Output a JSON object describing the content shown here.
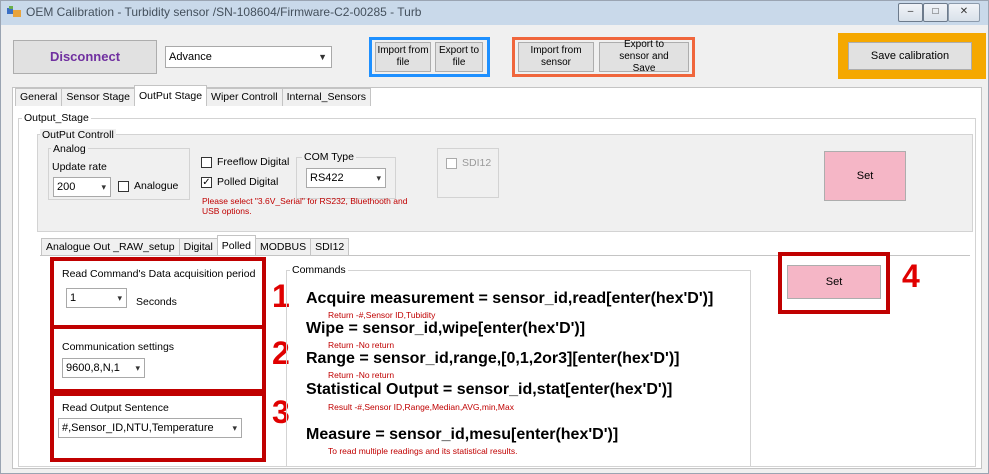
{
  "window": {
    "title": "OEM Calibration - Turbidity sensor /SN-108604/Firmware-C2-00285 - Turb",
    "controls": [
      "–",
      "□",
      "✕"
    ]
  },
  "toolbar": {
    "disconnect_label": "Disconnect",
    "mode_value": "Advance",
    "import_file_label": "Import from file",
    "export_file_label": "Export to file",
    "import_sensor_label": "Import from sensor",
    "export_sensor_label": "Export to sensor and Save",
    "save_calibration_label": "Save calibration"
  },
  "colors": {
    "blue_outline": "#1e90ff",
    "orange_outline": "#f0663c",
    "gold_panel": "#f5a800",
    "pink_button": "#f5b6c6",
    "red_highlight": "#c00000",
    "disconnect_text": "#7030a0"
  },
  "main_tabs": [
    "General",
    "Sensor Stage",
    "OutPut Stage",
    "Wiper Controll",
    "Internal_Sensors"
  ],
  "main_tabs_active": "OutPut Stage",
  "output_stage": {
    "group_label": "Output_Stage",
    "control_label": "OutPut Controll",
    "analog": {
      "group_label": "Analog",
      "update_rate_label": "Update rate",
      "update_rate_value": "200",
      "analogue_label": "Analogue",
      "analogue_checked": false
    },
    "freeflow_label": "Freeflow Digital",
    "freeflow_checked": false,
    "polled_label": "Polled Digital",
    "polled_checked": true,
    "com_type_label": "COM Type",
    "com_type_value": "RS422",
    "warning_line1": "Please select \"3.6V_Serial\" for RS232, Bluethooth and",
    "warning_line2": "USB options.",
    "sdi12_label": "SDI12",
    "sdi12_checked": false,
    "set_label": "Set"
  },
  "sub_tabs": [
    "Analogue Out _RAW_setup",
    "Digital",
    "Polled",
    "MODBUS",
    "SDI12"
  ],
  "sub_tabs_active": "Polled",
  "polled": {
    "period_group_label": "Read Command's Data acquisition period",
    "period_value": "1",
    "period_unit": "Seconds",
    "comm_group_label": "Communication settings",
    "comm_value": "9600,8,N,1",
    "output_group_label": "Read Output Sentence",
    "output_value": "#,Sensor_ID,NTU,Temperature",
    "commands_label": "Commands",
    "set_label": "Set",
    "markers": [
      "1",
      "2",
      "3",
      "4"
    ],
    "commands": [
      {
        "text": "Acquire measurement = sensor_id,read[enter(hex'D')]",
        "note": "Return -#,Sensor ID,Tubidity"
      },
      {
        "text": "Wipe = sensor_id,wipe[enter(hex'D')]",
        "note": "Return -No return"
      },
      {
        "text": "Range = sensor_id,range,[0,1,2or3][enter(hex'D')]",
        "note": "Return -No return"
      },
      {
        "text": "Statistical Output = sensor_id,stat[enter(hex'D')]",
        "note": "Result -#,Sensor ID,Range,Median,AVG,min,Max"
      },
      {
        "text": "Measure = sensor_id,mesu[enter(hex'D')]",
        "note": "To read multiple readings and its statistical results."
      }
    ]
  }
}
